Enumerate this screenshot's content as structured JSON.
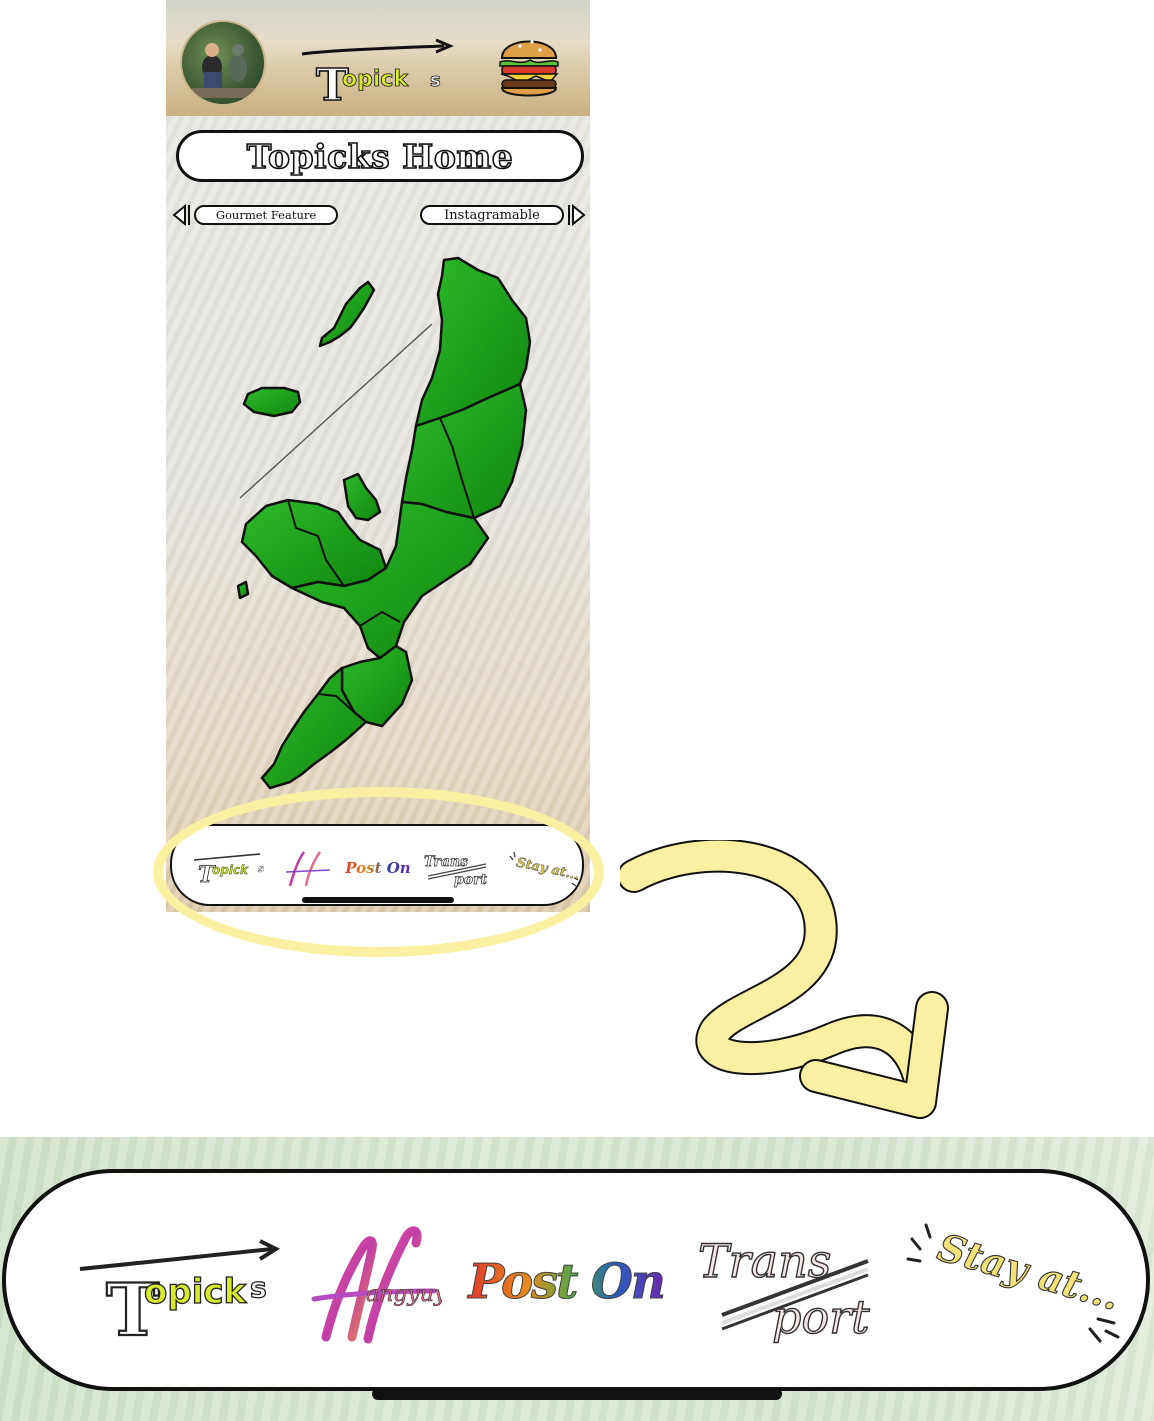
{
  "header": {
    "logo_text": "Topick s",
    "logo_parts": {
      "t": "T",
      "middle": "opick",
      "s": "s"
    }
  },
  "page": {
    "title": "Topicks Home",
    "prev_label": "Gourmet Feature",
    "next_label": "Instagramable"
  },
  "tabbar": {
    "tabs": [
      {
        "label": "Topick s",
        "icon": "topicks-logo"
      },
      {
        "label": "Hangout",
        "icon": "hangout-logo"
      },
      {
        "label": "Post On",
        "icon": "post-on-logo"
      },
      {
        "label": "Trans Port",
        "icon": "transport-logo",
        "line1": "Trans",
        "line2": "port"
      },
      {
        "label": "Stay at...",
        "icon": "stay-at-logo"
      }
    ]
  },
  "colors": {
    "map_green": "#1ea21a",
    "highlight_yellow": "#fbf0a2",
    "logo_yellow": "#d7ea2e"
  }
}
